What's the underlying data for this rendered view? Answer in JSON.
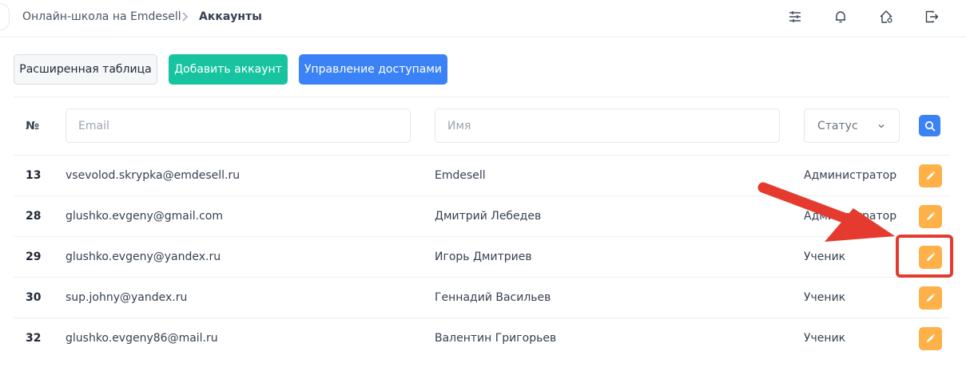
{
  "breadcrumb": {
    "root": "Онлайн-школа на Emdesell",
    "current": "Аккаунты"
  },
  "header_icons": [
    "sliders-icon",
    "bell-icon",
    "home-settings-icon",
    "logout-icon"
  ],
  "toolbar": {
    "extended_table_label": "Расширенная таблица",
    "add_account_label": "Добавить аккаунт",
    "access_management_label": "Управление доступами"
  },
  "filters": {
    "no_header": "№",
    "email_placeholder": "Email",
    "name_placeholder": "Имя",
    "status_label": "Статус"
  },
  "rows": [
    {
      "no": "13",
      "email": "vsevolod.skrypka@emdesell.ru",
      "name": "Emdesell",
      "status": "Администратор"
    },
    {
      "no": "28",
      "email": "glushko.evgeny@gmail.com",
      "name": "Дмитрий Лебедев",
      "status": "Администратор"
    },
    {
      "no": "29",
      "email": "glushko.evgeny@yandex.ru",
      "name": "Игорь Дмитриев",
      "status": "Ученик"
    },
    {
      "no": "30",
      "email": "sup.johny@yandex.ru",
      "name": "Геннадий Васильев",
      "status": "Ученик"
    },
    {
      "no": "32",
      "email": "glushko.evgeny86@mail.ru",
      "name": "Валентин Григорьев",
      "status": "Ученик"
    }
  ],
  "colors": {
    "add_button": "#17c49f",
    "access_button": "#3b82f6",
    "edit_button": "#fdb148",
    "annotation": "#e43b2e"
  }
}
